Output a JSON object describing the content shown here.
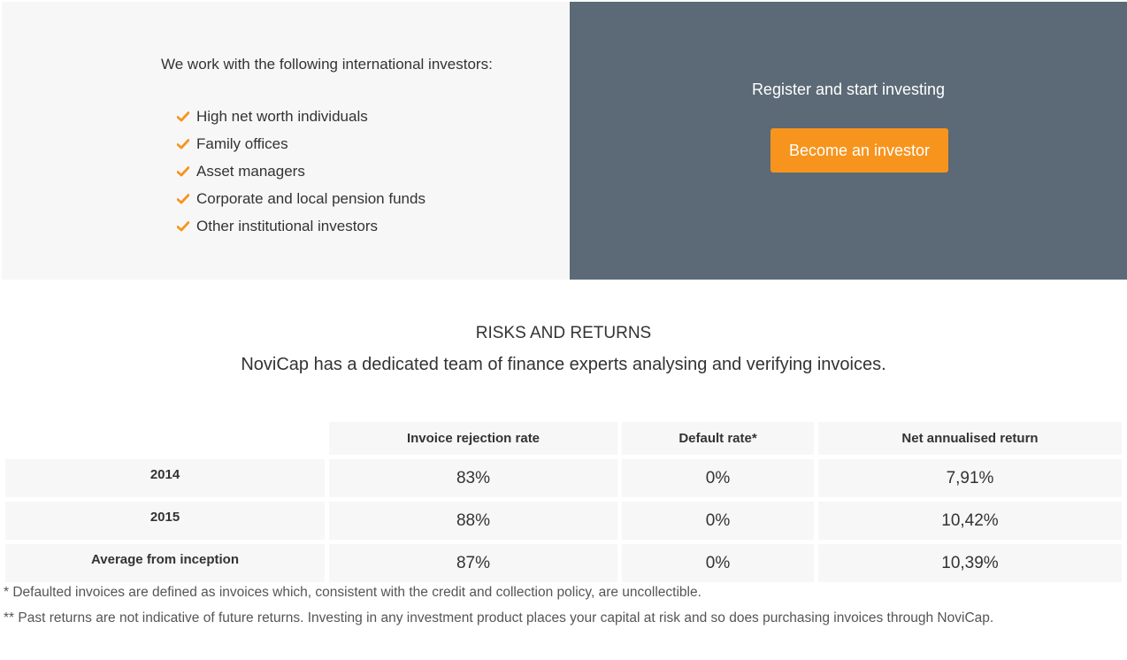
{
  "investors": {
    "intro": "We work with the following international investors:",
    "items": [
      "High net worth individuals",
      "Family offices",
      "Asset managers",
      "Corporate and local pension funds",
      "Other institutional investors"
    ],
    "check_color": "#f7941d"
  },
  "register": {
    "title": "Register and start investing",
    "button_label": "Become an investor",
    "button_color": "#f7941d",
    "panel_color": "#5b6a76"
  },
  "risks": {
    "title": "RISKS AND RETURNS",
    "subtitle": "NoviCap has a dedicated team of finance experts analysing and verifying invoices.",
    "table": {
      "headers": [
        "Invoice rejection rate",
        "Default rate*",
        "Net annualised return"
      ],
      "rows": [
        {
          "label": "2014",
          "values": [
            "83%",
            "0%",
            "7,91%"
          ]
        },
        {
          "label": "2015",
          "values": [
            "88%",
            "0%",
            "10,42%"
          ]
        },
        {
          "label": "Average from inception",
          "values": [
            "87%",
            "0%",
            "10,39%"
          ]
        }
      ]
    },
    "footnotes": [
      "* Defaulted invoices are defined as invoices which, consistent with the credit and collection policy, are uncollectible.",
      "** Past returns are not indicative of future returns. Investing in any investment product places your capital at risk and so does purchasing invoices through NoviCap."
    ]
  }
}
